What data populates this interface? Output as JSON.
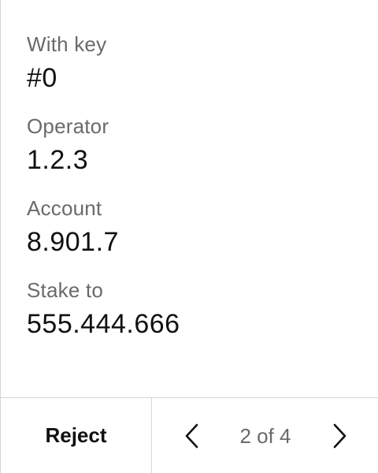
{
  "fields": [
    {
      "label": "With key",
      "value": "#0"
    },
    {
      "label": "Operator",
      "value": "1.2.3"
    },
    {
      "label": "Account",
      "value": "8.901.7"
    },
    {
      "label": "Stake to",
      "value": "555.444.666"
    }
  ],
  "footer": {
    "reject_label": "Reject",
    "page_indicator": "2 of 4",
    "prev_icon": "chevron-left-icon",
    "next_icon": "chevron-right-icon"
  },
  "colors": {
    "label": "#6a6a6a",
    "value": "#111111",
    "divider": "#d6d6d6",
    "background": "#ffffff"
  }
}
